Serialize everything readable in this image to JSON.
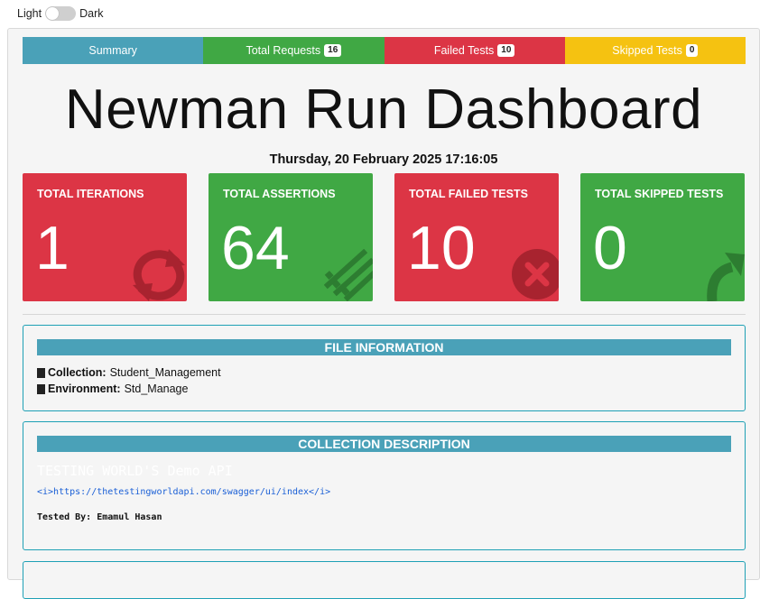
{
  "theme_toggle": {
    "light_label": "Light",
    "dark_label": "Dark"
  },
  "tabs": [
    {
      "label": "Summary",
      "badge": "",
      "color": "#4aa1b8"
    },
    {
      "label": "Total Requests",
      "badge": "16",
      "color": "#40a844"
    },
    {
      "label": "Failed Tests",
      "badge": "10",
      "color": "#dc3545"
    },
    {
      "label": "Skipped Tests",
      "badge": "0",
      "color": "#f1c40f"
    }
  ],
  "title": "Newman Run Dashboard",
  "date": "Thursday, 20 February 2025 17:16:05",
  "cards": [
    {
      "label": "TOTAL ITERATIONS",
      "value": "1",
      "color": "#dc3545",
      "icon": "sync-icon"
    },
    {
      "label": "TOTAL ASSERTIONS",
      "value": "64",
      "color": "#40a844",
      "icon": "list-check-icon"
    },
    {
      "label": "TOTAL FAILED TESTS",
      "value": "10",
      "color": "#dc3545",
      "icon": "times-circle-icon"
    },
    {
      "label": "TOTAL SKIPPED TESTS",
      "value": "0",
      "color": "#40a844",
      "icon": "share-arrow-icon"
    }
  ],
  "file_info": {
    "heading": "FILE INFORMATION",
    "collection_label": "Collection:",
    "collection_value": "Student_Management",
    "environment_label": "Environment:",
    "environment_value": "Std_Manage"
  },
  "collection_description": {
    "heading": "COLLECTION DESCRIPTION",
    "api_title": "TESTING WORLD'S Demo API",
    "link": "<i>https://thetestingworldapi.com/swagger/ui/index</i>",
    "tested_by": "Tested By: Emamul Hasan"
  }
}
